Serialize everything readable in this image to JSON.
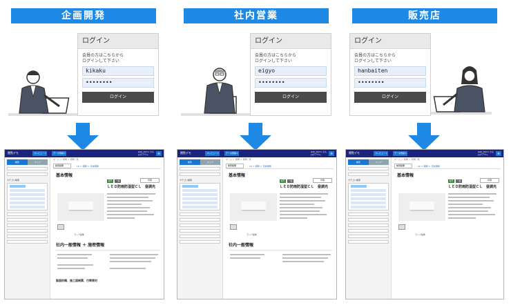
{
  "columns": [
    {
      "header": "企画開発",
      "login": {
        "title": "ログイン",
        "message_line1": "会員の方はこちらから",
        "message_line2": "ログインして下さい",
        "user_value": "kikaku",
        "password_value": "••••••••",
        "button_label": "ログイン"
      },
      "person": "male-worker",
      "app_sections": {
        "basic": "基本情報",
        "internal": "社内一般情報 ＋ 施密情報",
        "footer": "製図依頼、施工図帳票、付帯資材"
      }
    },
    {
      "header": "社内営業",
      "login": {
        "title": "ログイン",
        "message_line1": "会員の方はこちらから",
        "message_line2": "ログインして下さい",
        "user_value": "eigyo",
        "password_value": "••••••••",
        "button_label": "ログイン"
      },
      "person": "male-manager",
      "app_sections": {
        "basic": "基本情報",
        "internal": "社内一般情報",
        "footer": ""
      }
    },
    {
      "header": "販売店",
      "login": {
        "title": "ログイン",
        "message_line1": "会員の方はこちらから",
        "message_line2": "ログインして下さい",
        "user_value": "hanbaiten",
        "password_value": "••••••••",
        "button_label": "ログイン"
      },
      "person": "female-worker",
      "app_sections": {
        "basic": "基本情報",
        "internal": "",
        "footer": ""
      }
    }
  ],
  "app": {
    "logo": "閲覧デモ",
    "toolbar1": "プレビュー ▾",
    "toolbar2": "データ登録 ▾",
    "user": "web_demo さん",
    "logout": "ログアウト",
    "side_tab1": "検索",
    "side_tab2": "マップ",
    "side_heading": "カテゴリ検索",
    "crumb": "ホーム ＞ 照明 ＞ 照明一覧",
    "tab_label": "検索結果",
    "path_label": "LR ＞ 照明 ＞ 天井照明",
    "btn_label": "印刷",
    "product_name": "ＬＥＤ防雨防湿型ＣＬ　昼調光",
    "badge1": "販売",
    "badge2": "一般",
    "caption": "ランプ画像"
  },
  "colors": {
    "header": "#1e88e5",
    "arrow": "#1e88e5",
    "appbar": "#1a237e",
    "badge_green": "#2e7d32",
    "badge_gray": "#616161"
  }
}
